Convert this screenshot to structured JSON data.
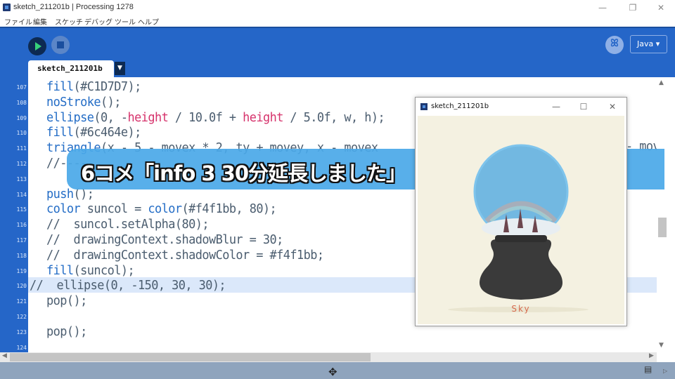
{
  "window": {
    "title": "sketch_211201b | Processing 1278",
    "minimize": "—",
    "maximize": "❐",
    "close": "✕"
  },
  "menu": [
    "ファイル",
    "編集",
    "スケッチ",
    "デバッグ",
    "ツール",
    "ヘルプ"
  ],
  "toolbar": {
    "run_icon": "play-icon",
    "stop_icon": "stop-icon",
    "debug_icon": "debugger-icon",
    "debug_glyph": "ꕤ",
    "mode_label": "Java ▾"
  },
  "tab": {
    "label": "sketch_211201b",
    "menu_glyph": "▼"
  },
  "editor": {
    "line_numbers": [
      "107",
      "108",
      "109",
      "110",
      "111",
      "112",
      "113",
      "114",
      "115",
      "116",
      "117",
      "118",
      "119",
      "120",
      "121",
      "122",
      "123",
      "124"
    ],
    "lines": [
      [
        {
          "t": "fill",
          "c": "kw"
        },
        {
          "t": "(#C1D7D7);",
          "c": ""
        }
      ],
      [
        {
          "t": "noStroke",
          "c": "kw"
        },
        {
          "t": "();",
          "c": ""
        }
      ],
      [
        {
          "t": "ellipse",
          "c": "kw"
        },
        {
          "t": "(0, -",
          "c": ""
        },
        {
          "t": "height",
          "c": "red"
        },
        {
          "t": " / 10.0f + ",
          "c": ""
        },
        {
          "t": "height",
          "c": "red"
        },
        {
          "t": " / 5.0f, w, h);",
          "c": ""
        }
      ],
      [
        {
          "t": "fill",
          "c": "kw"
        },
        {
          "t": "(#6c464e);",
          "c": ""
        }
      ],
      [
        {
          "t": "triangle",
          "c": "kw"
        },
        {
          "t": "(x - 5 - movex * 2, ty + movey, x - movex",
          "c": ""
        }
      ],
      [
        {
          "t": "//-----",
          "c": ""
        }
      ],
      [],
      [
        {
          "t": "push",
          "c": "kw"
        },
        {
          "t": "();",
          "c": ""
        }
      ],
      [
        {
          "t": "color",
          "c": "kw"
        },
        {
          "t": " suncol = ",
          "c": ""
        },
        {
          "t": "color",
          "c": "kw"
        },
        {
          "t": "(#f4f1bb, 80);",
          "c": ""
        }
      ],
      [
        {
          "t": "//  suncol.setAlpha(80);",
          "c": ""
        }
      ],
      [
        {
          "t": "//  drawingContext.shadowBlur = 30;",
          "c": ""
        }
      ],
      [
        {
          "t": "//  drawingContext.shadowColor = #f4f1bb;",
          "c": ""
        }
      ],
      [
        {
          "t": "fill",
          "c": "kw"
        },
        {
          "t": "(suncol);",
          "c": ""
        }
      ],
      [
        {
          "t": "//  ellipse(0, -150, 30, 30);",
          "c": ""
        }
      ],
      [
        {
          "t": "pop",
          "c": ""
        },
        {
          "t": "();",
          "c": ""
        }
      ],
      [],
      [
        {
          "t": "pop",
          "c": ""
        },
        {
          "t": "();",
          "c": ""
        }
      ],
      []
    ],
    "overflow_text": "- mov",
    "highlight_line_index": 13
  },
  "caption": {
    "text": "6コメ「info 3 30分延長しました」"
  },
  "sketch_window": {
    "title": "sketch_211201b",
    "minimize": "—",
    "maximize": "☐",
    "close": "✕",
    "label": "Sky",
    "colors": {
      "background": "#f4f1e1",
      "globe": "#5aaee0",
      "base": "#3a3a3a",
      "label": "#d76b4f"
    }
  },
  "statusbar": {
    "move_icon": "✥",
    "console_icon": "▤",
    "console_arrow": "▷"
  },
  "colors": {
    "toolbar": "#2566c8",
    "highlight": "#dbe8fa",
    "keyword": "#246dc6",
    "constant": "#d6336c"
  }
}
